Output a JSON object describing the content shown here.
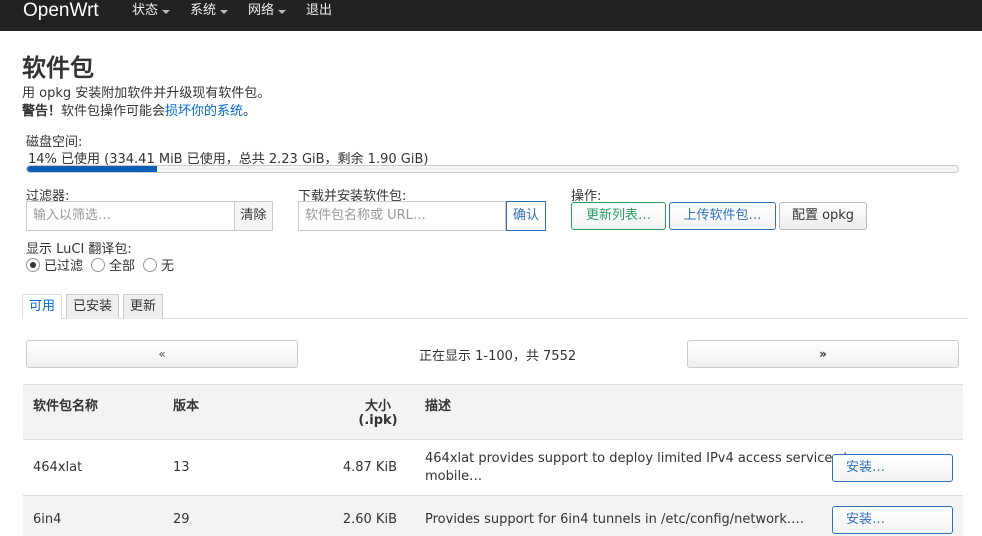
{
  "nav": {
    "brand": "OpenWrt",
    "menu": [
      {
        "label": "状态",
        "dropdown": true
      },
      {
        "label": "系统",
        "dropdown": true
      },
      {
        "label": "网络",
        "dropdown": true
      },
      {
        "label": "退出",
        "dropdown": false
      }
    ]
  },
  "page": {
    "title": "软件包",
    "intro": "用 opkg 安装附加软件并升级现有软件包。",
    "warning_label": "警告！",
    "warning_text": "软件包操作可能会",
    "warning_link": "损坏你的系统",
    "warning_end": "。"
  },
  "disk": {
    "label": "磁盘空间:",
    "usage_text": "14% 已使用 (334.41 MiB 已使用，总共 2.23 GiB，剩余 1.90 GiB)",
    "percent_used": 14
  },
  "filter": {
    "label": "过滤器:",
    "placeholder": "输入以筛选…",
    "clear_label": "清除"
  },
  "download": {
    "label": "下载并安装软件包:",
    "placeholder": "软件包名称或 URL…",
    "confirm_label": "确认"
  },
  "actions": {
    "label": "操作:",
    "update_label": "更新列表…",
    "upload_label": "上传软件包…",
    "configure_label": "配置 opkg"
  },
  "luci": {
    "label": "显示 LuCI 翻译包:",
    "options": [
      "已过滤",
      "全部",
      "无"
    ],
    "selected": "已过滤"
  },
  "tabs": [
    {
      "label": "可用",
      "active": true
    },
    {
      "label": "已安装",
      "active": false
    },
    {
      "label": "更新",
      "active": false
    }
  ],
  "pager": {
    "prev": "«",
    "next": "»",
    "status": "正在显示 1-100，共 7552"
  },
  "table": {
    "headers": {
      "name": "软件包名称",
      "version": "版本",
      "size_line1": "大小",
      "size_line2": "(.ipk)",
      "description": "描述"
    },
    "rows": [
      {
        "name": "464xlat",
        "version": "13",
        "size": "4.87 KiB",
        "description_line1": "464xlat provides support to deploy limited IPv4 access services to",
        "description_line2": "mobile…",
        "action": "安装…"
      },
      {
        "name": "6in4",
        "version": "29",
        "size": "2.60 KiB",
        "description_line1": "Provides support for 6in4 tunnels in /etc/config/network.…",
        "description_line2": "",
        "action": "安装…"
      }
    ]
  },
  "colors": {
    "navbar": "#222222",
    "link": "#0069d6",
    "progress": "#0d5fb6",
    "green": "#2e9e67",
    "blue": "#2f72c0"
  }
}
